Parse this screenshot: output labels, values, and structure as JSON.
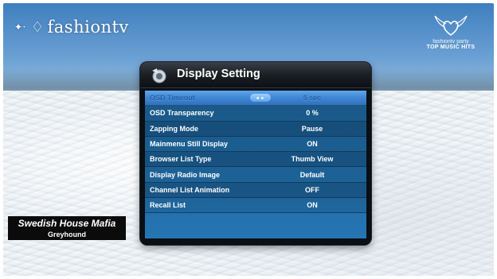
{
  "branding": {
    "channel_logo": "fashiontv",
    "emblem_line1": "fashiontv party",
    "emblem_line2": "TOP MUSIC HITS"
  },
  "now_playing": {
    "artist": "Swedish House Mafia",
    "track": "Greyhound"
  },
  "dialog": {
    "title": "Display Setting",
    "icon": "settings-globe-icon",
    "selected_index": 0,
    "rows": [
      {
        "label": "OSD Timeout",
        "value": "5 sec"
      },
      {
        "label": "OSD Transparency",
        "value": "0 %"
      },
      {
        "label": "Zapping Mode",
        "value": "Pause"
      },
      {
        "label": "Mainmenu Still Display",
        "value": "ON"
      },
      {
        "label": "Browser List Type",
        "value": "Thumb View"
      },
      {
        "label": "Display Radio Image",
        "value": "Default"
      },
      {
        "label": "Channel List Animation",
        "value": "OFF"
      },
      {
        "label": "Recall List",
        "value": "ON"
      }
    ]
  },
  "colors": {
    "selection_highlight": "#4a8fd8",
    "list_background": "#1f6aa3",
    "dialog_frame": "#0a0f14"
  }
}
